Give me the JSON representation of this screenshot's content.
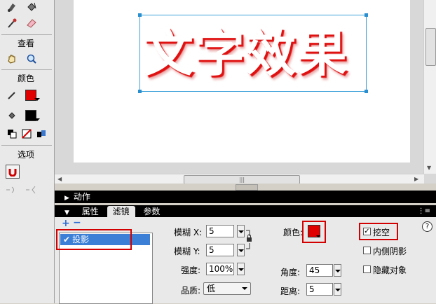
{
  "tools": {
    "view_label": "查看",
    "colors_label": "颜色",
    "options_label": "选项"
  },
  "stage": {
    "text": "文字效果"
  },
  "panels": {
    "actions_title": "动作",
    "tabs": [
      {
        "label": "属性",
        "active": false
      },
      {
        "label": "滤镜",
        "active": true
      },
      {
        "label": "参数",
        "active": false
      }
    ]
  },
  "filter": {
    "add_icon": "plus-icon",
    "remove_icon": "minus-icon",
    "list_items": [
      "投影"
    ],
    "blur_x_label": "模糊 X:",
    "blur_x_value": "5",
    "blur_y_label": "模糊 Y:",
    "blur_y_value": "5",
    "strength_label": "强度:",
    "strength_value": "100%",
    "quality_label": "品质:",
    "quality_value": "低",
    "color_label": "颜色:",
    "color_value": "#e00000",
    "angle_label": "角度:",
    "angle_value": "45",
    "distance_label": "距离:",
    "distance_value": "5",
    "knockout_label": "挖空",
    "knockout_checked": true,
    "inner_shadow_label": "内侧阴影",
    "inner_shadow_checked": false,
    "hide_object_label": "隐藏对象",
    "hide_object_checked": false
  },
  "colors": {
    "accent_blue": "#3aa0d8",
    "shadow_red": "#e01010",
    "highlight_frame": "#d20000"
  }
}
